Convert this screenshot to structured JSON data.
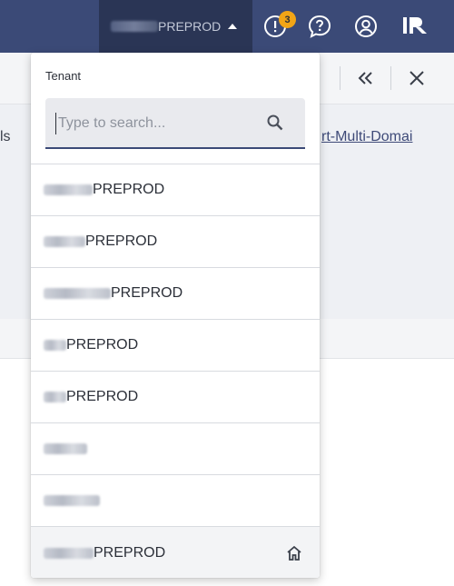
{
  "topbar": {
    "current_tenant_suffix": "PREPROD",
    "notification_count": "3",
    "icons": [
      "caret-up-icon",
      "alert-icon",
      "help-chat-icon",
      "user-account-icon",
      "app-logo-icon"
    ]
  },
  "panel": {
    "left_text_fragment": "ls",
    "link_fragment": "rt-Multi-Domai"
  },
  "dropdown": {
    "title": "Tenant",
    "search_placeholder": "Type to search...",
    "items": [
      {
        "suffix": "PREPROD",
        "blur_width": 54
      },
      {
        "suffix": "PREPROD",
        "blur_width": 46
      },
      {
        "suffix": "PREPROD",
        "blur_width": 74
      },
      {
        "suffix": "PREPROD",
        "blur_width": 25
      },
      {
        "suffix": "PREPROD",
        "blur_width": 25
      },
      {
        "suffix": "",
        "blur_width": 48
      },
      {
        "suffix": "",
        "blur_width": 62
      }
    ],
    "selected_item": {
      "suffix": "PREPROD",
      "blur_width": 55
    }
  },
  "colors": {
    "topbar": "#3b4a77",
    "topbar_active": "#2a3555",
    "badge": "#f2a516",
    "accent": "#3b4a77"
  }
}
